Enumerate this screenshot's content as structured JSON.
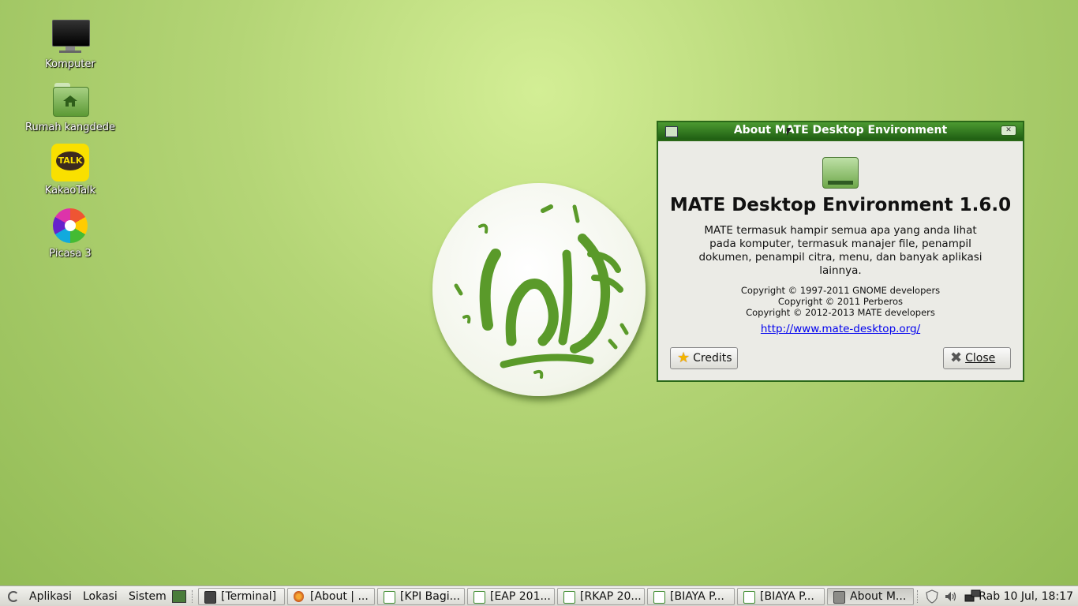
{
  "desktop": {
    "icons": [
      {
        "label": "Komputer"
      },
      {
        "label": "Rumah kangdede"
      },
      {
        "label": "KakaoTalk"
      },
      {
        "label": "Picasa 3"
      }
    ],
    "kakao_badge": "TALK"
  },
  "dialog": {
    "title": "About MATE Desktop Environment",
    "program_name": "MATE Desktop Environment 1.6.0",
    "comments": "MATE termasuk hampir semua apa yang anda lihat pada komputer, termasuk manajer file, penampil dokumen, penampil citra, menu, dan banyak aplikasi lainnya.",
    "copyright": "Copyright © 1997-2011 GNOME developers\nCopyright © 2011 Perberos\nCopyright © 2012-2013 MATE developers",
    "website": "http://www.mate-desktop.org/",
    "credits_label": "Credits",
    "close_label": "Close"
  },
  "taskbar": {
    "menus": [
      "Aplikasi",
      "Lokasi",
      "Sistem"
    ],
    "tasks": [
      {
        "label": "[Terminal]",
        "icon": "terminal-icon"
      },
      {
        "label": "[About | ...",
        "icon": "firefox-icon"
      },
      {
        "label": "[KPI Bagi...",
        "icon": "spreadsheet-icon"
      },
      {
        "label": "[EAP 201...",
        "icon": "spreadsheet-icon"
      },
      {
        "label": "[RKAP 20...",
        "icon": "spreadsheet-icon"
      },
      {
        "label": "[BIAYA P...",
        "icon": "spreadsheet-icon"
      },
      {
        "label": "[BIAYA P...",
        "icon": "spreadsheet-icon"
      },
      {
        "label": "About M...",
        "icon": "window-icon",
        "active": true
      }
    ],
    "clock": "Rab 10 Jul, 18:17"
  }
}
